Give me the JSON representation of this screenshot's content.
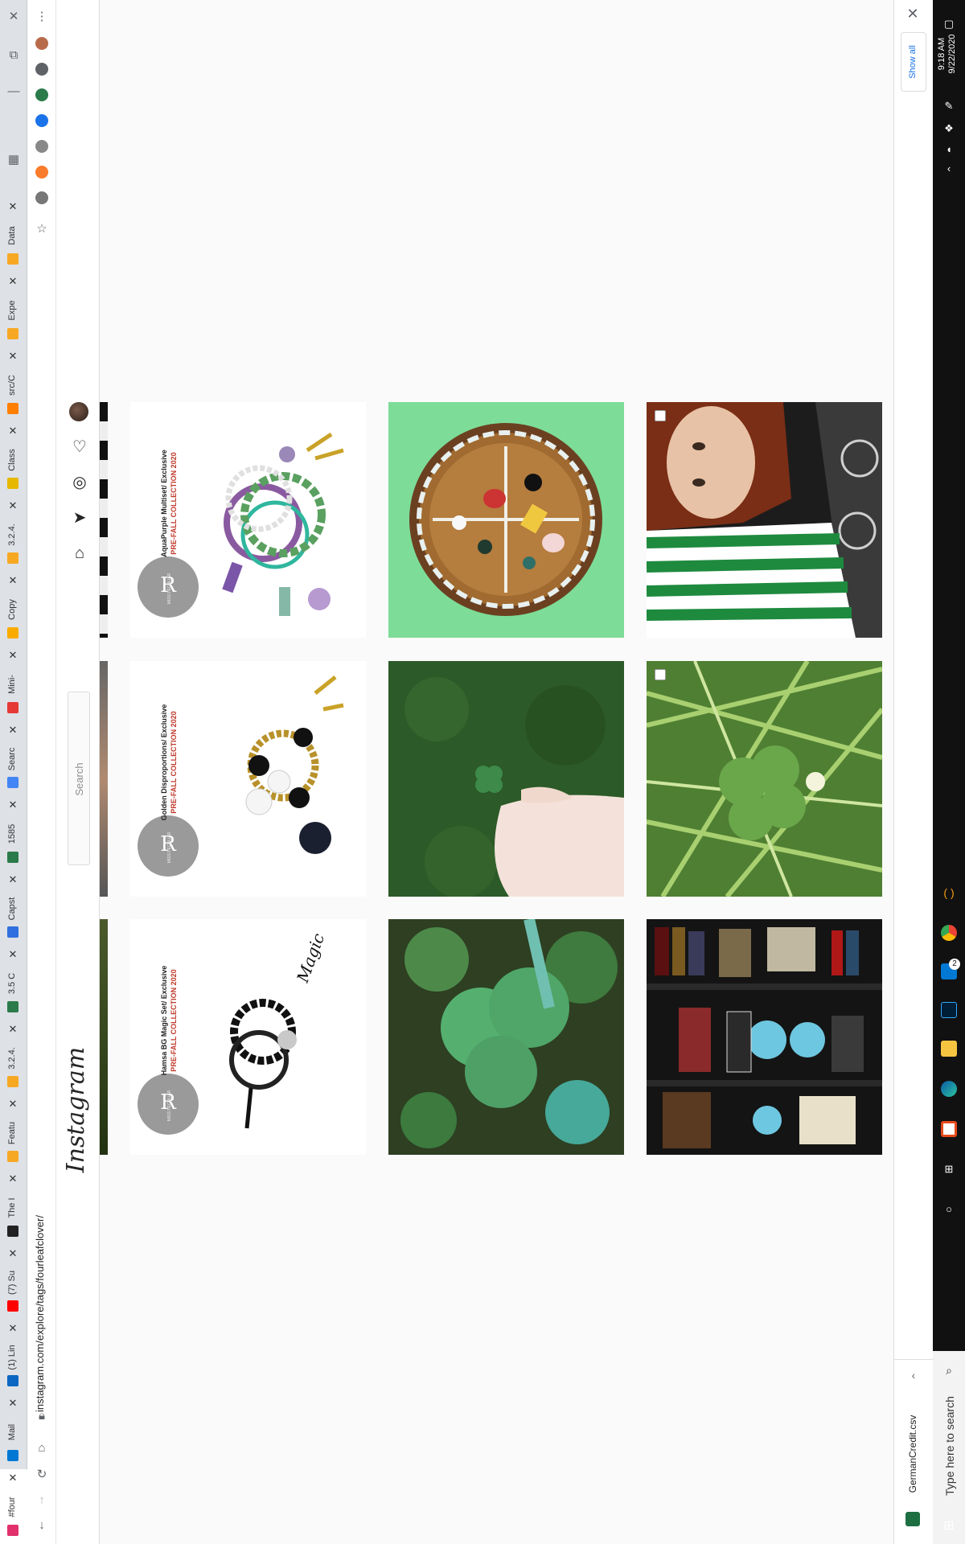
{
  "browser": {
    "url": "instagram.com/explore/tags/fourleafclover/",
    "tabs": [
      {
        "label": "#four",
        "color": "#e1306c",
        "active": true
      },
      {
        "label": "Mail",
        "color": "#0078d4"
      },
      {
        "label": "(1) Lin",
        "color": "#0a66c2"
      },
      {
        "label": "(7) Su",
        "color": "#ff0000"
      },
      {
        "label": "The I",
        "color": "#222222"
      },
      {
        "label": "Featu",
        "color": "#f7a823"
      },
      {
        "label": "3.2.4.",
        "color": "#f7a823"
      },
      {
        "label": "3.5 C",
        "color": "#2a7a4a"
      },
      {
        "label": "Capst",
        "color": "#2f6fdf"
      },
      {
        "label": "1585",
        "color": "#2a7a4a"
      },
      {
        "label": "Searc",
        "color": "#4285f4"
      },
      {
        "label": "Mini-",
        "color": "#e53935"
      },
      {
        "label": "Copy",
        "color": "#f9ab00"
      },
      {
        "label": "3.2.4.",
        "color": "#f7a823"
      },
      {
        "label": "Class",
        "color": "#e6b800"
      },
      {
        "label": "src/C",
        "color": "#ff7f00"
      },
      {
        "label": "Expe",
        "color": "#f7a823"
      },
      {
        "label": "Data",
        "color": "#f7a823"
      }
    ],
    "downloads": {
      "show_all": "Show all",
      "file": "GermanCredit.csv"
    },
    "extensions": [
      {
        "name": "profile-z-icon",
        "color": "#b86b4b"
      },
      {
        "name": "puzzle-icon",
        "color": "#5f6368"
      },
      {
        "name": "stocks-icon",
        "color": "#2a7a4a"
      },
      {
        "name": "translate-icon",
        "color": "#1a73e8"
      },
      {
        "name": "circle-icon",
        "color": "#888888"
      },
      {
        "name": "x-ext-icon",
        "color": "#f97b2c"
      },
      {
        "name": "g-ext-icon",
        "color": "#777777"
      }
    ]
  },
  "instagram": {
    "logo": "Instagram",
    "search_placeholder": "Search"
  },
  "posts": [
    {
      "name": "bracelet-aquapurple",
      "caption": "AquaPurple Multiset/ Exclusive",
      "sub": "PRE-FALL COLLECTION 2020",
      "brand": "MISS PECULIAR"
    },
    {
      "name": "glass-dish-on-green"
    },
    {
      "name": "woman-celtic-jersey"
    },
    {
      "name": "bracelet-golden",
      "caption": "Golden Disproportions/ Exclusive",
      "sub": "PRE-FALL COLLECTION 2020",
      "brand": "MISS PECULIAR"
    },
    {
      "name": "hand-holding-clover"
    },
    {
      "name": "clover-in-grass"
    },
    {
      "name": "bracelet-hamsa",
      "caption": "Hamsa BG Magic Set/ Exclusive",
      "sub": "PRE-FALL COLLECTION 2020",
      "brand": "MISS PECULIAR"
    },
    {
      "name": "clover-closeup"
    },
    {
      "name": "bookshelf-figures"
    }
  ],
  "taskbar": {
    "time": "9:18 AM",
    "date": "9/22/2020",
    "search": "Type here to search",
    "mail_badge": "2"
  }
}
